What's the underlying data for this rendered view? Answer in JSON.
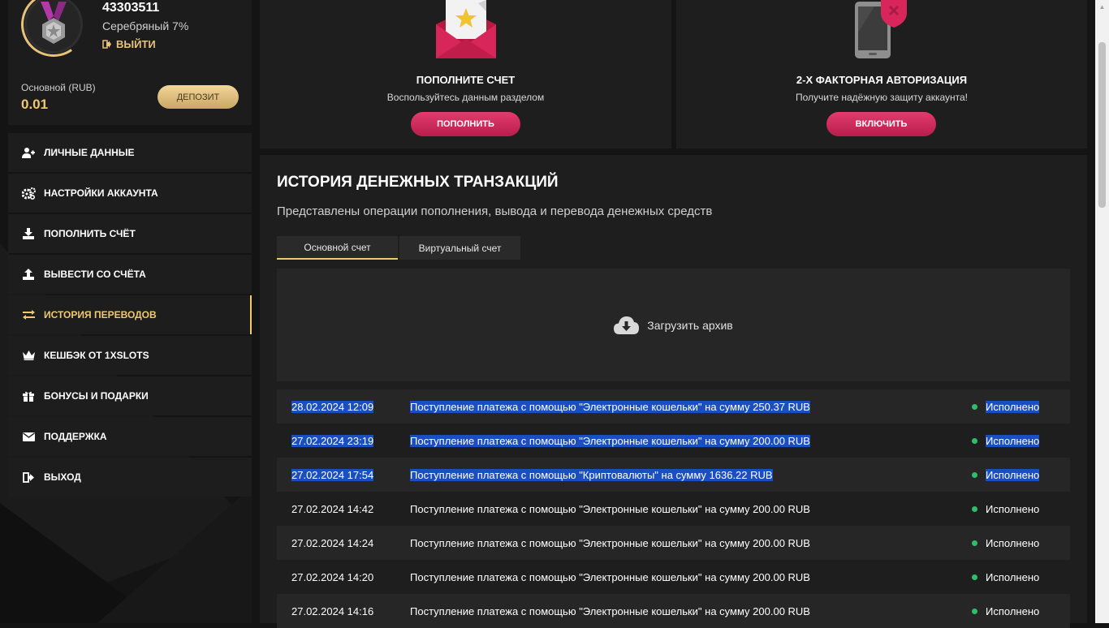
{
  "profile": {
    "user_id": "43303511",
    "level": "Серебряный 7%",
    "logout_label": "ВЫЙТИ",
    "balance_label": "Основной (RUB)",
    "balance_value": "0.01",
    "deposit_label": "ДЕПОЗИТ"
  },
  "menu": {
    "items": [
      {
        "label": "ЛИЧНЫЕ ДАННЫЕ",
        "icon": "user-edit-icon"
      },
      {
        "label": "НАСТРОЙКИ АККАУНТА",
        "icon": "gears-icon"
      },
      {
        "label": "ПОПОЛНИТЬ СЧЁТ",
        "icon": "download-icon"
      },
      {
        "label": "ВЫВЕСТИ СО СЧЁТА",
        "icon": "upload-icon"
      },
      {
        "label": "ИСТОРИЯ ПЕРЕВОДОВ",
        "icon": "transfer-arrows-icon",
        "active": true
      },
      {
        "label": "КЕШБЭК ОТ 1XSLOTS",
        "icon": "crown-icon"
      },
      {
        "label": "БОНУСЫ И ПОДАРКИ",
        "icon": "gift-icon"
      },
      {
        "label": "ПОДДЕРЖКА",
        "icon": "envelope-icon"
      },
      {
        "label": "ВЫХОД",
        "icon": "exit-icon"
      }
    ]
  },
  "cards": {
    "deposit": {
      "title": "ПОПОЛНИТЕ СЧЕТ",
      "subtitle": "Воспользуйтесь данным разделом",
      "button": "ПОПОЛНИТЬ",
      "icon": "envelope-star-icon"
    },
    "twofa": {
      "title": "2-Х ФАКТОРНАЯ АВТОРИЗАЦИЯ",
      "subtitle": "Получите надёжную защиту аккаунта!",
      "button": "ВКЛЮЧИТЬ",
      "icon": "phone-shield-icon"
    }
  },
  "history": {
    "title": "ИСТОРИЯ ДЕНЕЖНЫХ ТРАНЗАКЦИЙ",
    "subtitle": "Представлены операции пополнения, вывода и перевода денежных средств",
    "tabs": [
      "Основной счет",
      "Виртуальный счет"
    ],
    "archive_label": "Загрузить архив",
    "rows": [
      {
        "date": "28.02.2024 12:09",
        "desc": "Поступление платежа с помощью \"Электронные кошельки\" на сумму 250.37 RUB",
        "status": "Исполнено",
        "selected": true
      },
      {
        "date": "27.02.2024 23:19",
        "desc": "Поступление платежа с помощью \"Электронные кошельки\" на сумму 200.00 RUB",
        "status": "Исполнено",
        "selected": true
      },
      {
        "date": "27.02.2024 17:54",
        "desc": "Поступление платежа с помощью \"Криптовалюты\" на сумму 1636.22 RUB",
        "status": "Исполнено",
        "selected": true
      },
      {
        "date": "27.02.2024 14:42",
        "desc": "Поступление платежа с помощью \"Электронные кошельки\" на сумму 200.00 RUB",
        "status": "Исполнено",
        "selected": false
      },
      {
        "date": "27.02.2024 14:24",
        "desc": "Поступление платежа с помощью \"Электронные кошельки\" на сумму 200.00 RUB",
        "status": "Исполнено",
        "selected": false
      },
      {
        "date": "27.02.2024 14:20",
        "desc": "Поступление платежа с помощью \"Электронные кошельки\" на сумму 200.00 RUB",
        "status": "Исполнено",
        "selected": false
      },
      {
        "date": "27.02.2024 14:16",
        "desc": "Поступление платежа с помощью \"Электронные кошельки\" на сумму 200.00 RUB",
        "status": "Исполнено",
        "selected": false
      }
    ]
  },
  "colors": {
    "accent_gold": "#f0c870",
    "accent_pink": "#d42a5c",
    "status_ok": "#2ebd6b",
    "selection": "#1b4fbf"
  }
}
